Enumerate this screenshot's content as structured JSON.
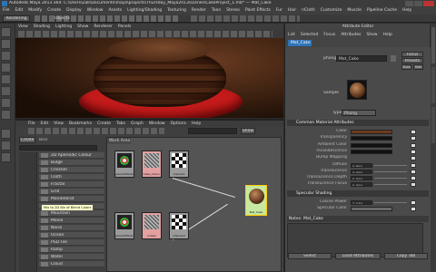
{
  "window": {
    "title": "Autodesk Maya 2013 x64: C:\\Users\\Zak\\Documents\\maya\\projects\\Thursday_Maya2013\\scenes\\CakeProject_1.mb* --- Mat_Cake"
  },
  "menubar": [
    "File",
    "Edit",
    "Modify",
    "Create",
    "Display",
    "Window",
    "Assets",
    "Lighting/Shading",
    "Texturing",
    "Render",
    "Toon",
    "Stereo",
    "Paint Effects",
    "Fur",
    "Hair",
    "nCloth",
    "Customize",
    "Muscle",
    "Pipeline Cache",
    "Help"
  ],
  "status": {
    "mode": "Rendering",
    "objects_label": "Objects"
  },
  "viewport": {
    "menus": [
      "View",
      "Shading",
      "Lighting",
      "Show",
      "Renderer",
      "Panels"
    ]
  },
  "hypershade": {
    "menus": [
      "File",
      "Edit",
      "View",
      "Bookmarks",
      "Create",
      "Tabs",
      "Graph",
      "Window",
      "Options",
      "Help"
    ],
    "work_tab": "Work Area",
    "tab_create": "Create",
    "tab_bins": "Bins",
    "show_button": "Show",
    "create_list": [
      "2D Aperiodic Colour",
      "Bulge",
      "Checker",
      "Cloth",
      "Fractal",
      "Grid",
      "Mandelbrot",
      "Mandelbrot3D",
      "Mountain",
      "Movie",
      "Noise",
      "Ocean",
      "PSD File",
      "Ramp",
      "Water",
      "Cloud"
    ],
    "tooltip": "Mix to 2D Bin of Blend Colors",
    "nodes_top": [
      {
        "label": "place2dTexture1",
        "kind": "flower"
      },
      {
        "label": "Cake_Colour",
        "kind": "noise"
      },
      {
        "label": "checker1",
        "kind": "checker"
      }
    ],
    "nodes_bottom": [
      {
        "label": "place2dTexture2",
        "kind": "flower"
      },
      {
        "label": "noise1",
        "kind": "noise"
      },
      {
        "label": "checker2",
        "kind": "checker"
      }
    ],
    "material_node": "Mat_Cake"
  },
  "attribute_editor": {
    "header": "Attribute Editor",
    "menus": [
      "List",
      "Selected",
      "Focus",
      "Attributes",
      "Show",
      "Help"
    ],
    "tab": "Mat_Cake",
    "shader_label": "phong:",
    "shader_name": "Mat_Cake",
    "focus_button": "Focus",
    "presets_button": "Presets",
    "show_button": "Show",
    "hide_button": "Hide",
    "sample_label": "Sample",
    "type_label": "Type",
    "type_value": "Phong",
    "section_common": "Common Material Attributes",
    "common_rows": [
      {
        "label": "Color",
        "swatch": "#6b3a1e"
      },
      {
        "label": "Transparency",
        "swatch": "#111111"
      },
      {
        "label": "Ambient Color",
        "swatch": "#111111"
      },
      {
        "label": "Incandescence",
        "swatch": "#111111"
      },
      {
        "label": "Bump Mapping",
        "swatch": ""
      },
      {
        "label": "Diffuse",
        "value": "0.800"
      },
      {
        "label": "Translucence",
        "value": "0.000"
      },
      {
        "label": "Translucence Depth",
        "value": "0.500"
      },
      {
        "label": "Translucence Focus",
        "value": "0.500"
      }
    ],
    "section_specular": "Specular Shading",
    "specular_rows": [
      {
        "label": "Cosine Power",
        "value": "2.070"
      },
      {
        "label": "Specular Color",
        "swatch": "#6a6a6a"
      }
    ],
    "notes_label": "Notes: Mat_Cake",
    "bottom_buttons": [
      "Select",
      "Load Attributes",
      "Copy Tab"
    ]
  },
  "colors": {
    "panel": "#444444",
    "accent_blue": "#2f73b8",
    "plate": "#d31b1b"
  }
}
